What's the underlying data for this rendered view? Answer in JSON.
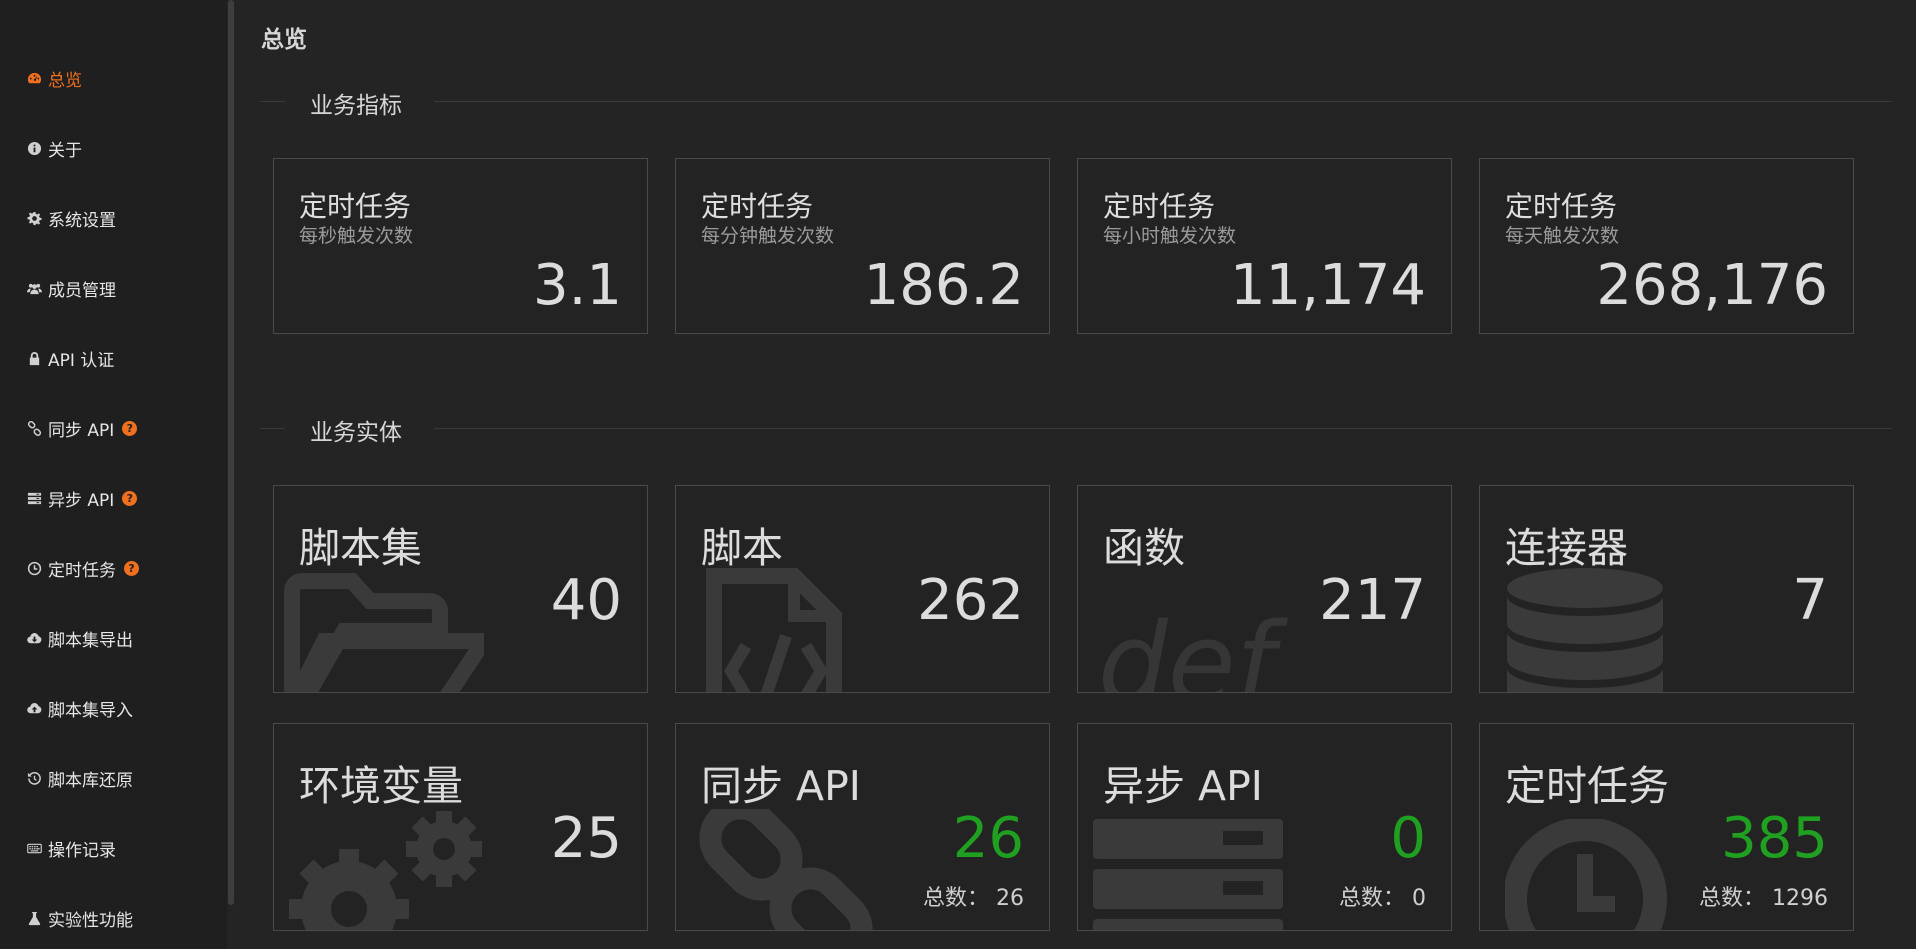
{
  "page_title": "总览",
  "sidebar": {
    "items": [
      {
        "label": "总览",
        "icon": "dashboard-icon",
        "active": true
      },
      {
        "label": "关于",
        "icon": "info-icon"
      },
      {
        "label": "系统设置",
        "icon": "gear-icon"
      },
      {
        "label": "成员管理",
        "icon": "users-icon"
      },
      {
        "label": "API 认证",
        "icon": "lock-icon"
      },
      {
        "label": "同步 API",
        "icon": "link-icon",
        "help": "?"
      },
      {
        "label": "异步 API",
        "icon": "server-icon",
        "help": "?"
      },
      {
        "label": "定时任务",
        "icon": "clock-icon",
        "help": "?"
      },
      {
        "label": "脚本集导出",
        "icon": "cloud-download-icon"
      },
      {
        "label": "脚本集导入",
        "icon": "cloud-upload-icon"
      },
      {
        "label": "脚本库还原",
        "icon": "history-icon"
      },
      {
        "label": "操作记录",
        "icon": "keyboard-icon"
      },
      {
        "label": "实验性功能",
        "icon": "flask-icon"
      }
    ]
  },
  "sections": {
    "metrics_label": "业务指标",
    "entities_label": "业务实体"
  },
  "metrics": [
    {
      "title": "定时任务",
      "subtitle": "每秒触发次数",
      "value": "3.1"
    },
    {
      "title": "定时任务",
      "subtitle": "每分钟触发次数",
      "value": "186.2"
    },
    {
      "title": "定时任务",
      "subtitle": "每小时触发次数",
      "value": "11,174"
    },
    {
      "title": "定时任务",
      "subtitle": "每天触发次数",
      "value": "268,176"
    }
  ],
  "entities": [
    {
      "title": "脚本集",
      "value": "40",
      "icon": "folder-icon"
    },
    {
      "title": "脚本",
      "value": "262",
      "icon": "code-file-icon"
    },
    {
      "title": "函数",
      "value": "217",
      "icon": "def-icon"
    },
    {
      "title": "连接器",
      "value": "7",
      "icon": "database-icon"
    },
    {
      "title": "环境变量",
      "value": "25",
      "icon": "gears-icon"
    },
    {
      "title": "同步 API",
      "value": "26",
      "total_label": "总数：",
      "total": "26",
      "icon": "link-icon",
      "value_color": "#20a020"
    },
    {
      "title": "异步 API",
      "value": "0",
      "total_label": "总数：",
      "total": "0",
      "icon": "server-icon",
      "value_color": "#20a020"
    },
    {
      "title": "定时任务",
      "value": "385",
      "total_label": "总数：",
      "total": "1296",
      "icon": "clock-icon",
      "value_color": "#20a020"
    }
  ],
  "colors": {
    "accent": "#f0701f",
    "success": "#20a020",
    "background": "#242424"
  }
}
